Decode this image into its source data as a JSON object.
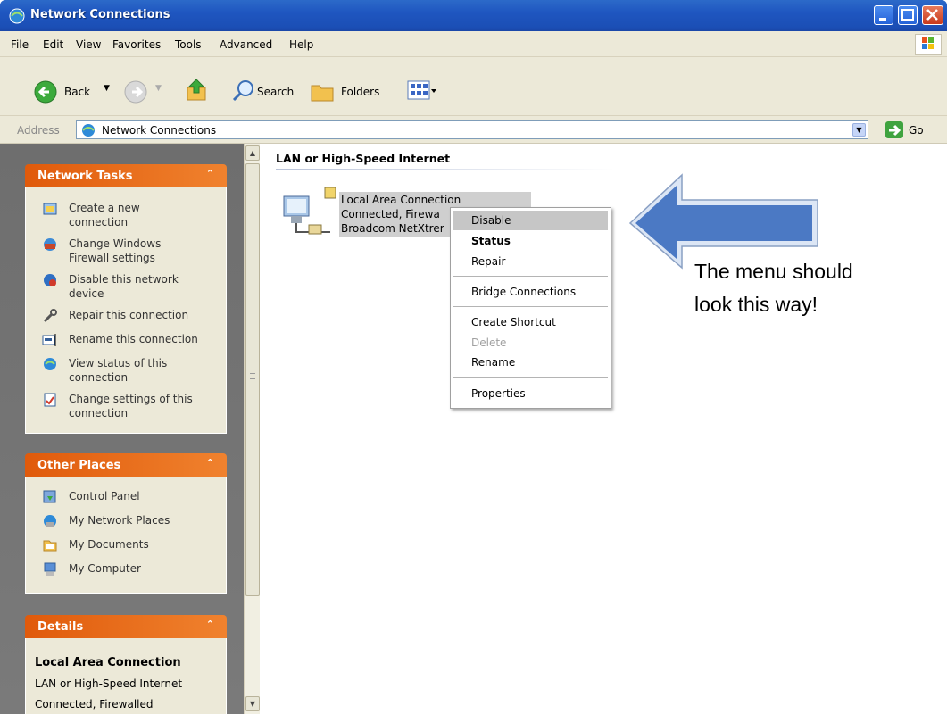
{
  "window": {
    "title": "Network Connections"
  },
  "menubar": {
    "items": [
      "File",
      "Edit",
      "View",
      "Favorites",
      "Tools",
      "Advanced",
      "Help"
    ]
  },
  "toolbar": {
    "back": "Back",
    "search": "Search",
    "folders": "Folders"
  },
  "address": {
    "label": "Address",
    "value": "Network Connections",
    "go": "Go"
  },
  "network_tasks": {
    "title": "Network Tasks",
    "items": [
      {
        "line1": "Create a new",
        "line2": "connection",
        "icon": "new-connection-icon"
      },
      {
        "line1": "Change Windows",
        "line2": "Firewall settings",
        "icon": "firewall-icon"
      },
      {
        "line1": "Disable this network",
        "line2": "device",
        "icon": "disable-icon"
      },
      {
        "line1": "Repair this connection",
        "line2": "",
        "icon": "repair-icon"
      },
      {
        "line1": "Rename this connection",
        "line2": "",
        "icon": "rename-icon"
      },
      {
        "line1": "View status of this",
        "line2": "connection",
        "icon": "status-icon"
      },
      {
        "line1": "Change settings of this",
        "line2": "connection",
        "icon": "settings-icon"
      }
    ]
  },
  "other_places": {
    "title": "Other Places",
    "items": [
      "Control Panel",
      "My Network Places",
      "My Documents",
      "My Computer"
    ]
  },
  "details": {
    "title": "Details",
    "name": "Local Area Connection",
    "type": "LAN or High-Speed Internet",
    "status": "Connected, Firewalled"
  },
  "content": {
    "group_header": "LAN or High-Speed Internet",
    "connection": {
      "name": "Local Area Connection",
      "status": "Connected, Firewa",
      "device": "Broadcom NetXtrer"
    }
  },
  "context_menu": {
    "items": [
      "Disable",
      "Status",
      "Repair",
      "Bridge Connections",
      "Create Shortcut",
      "Delete",
      "Rename",
      "Properties"
    ]
  },
  "annotation": {
    "line1": "The menu should",
    "line2": "look this way!"
  },
  "colors": {
    "titlebar": "#1f56c0",
    "panel_header": "#e05a0b",
    "arrow": "#4a78c2"
  }
}
